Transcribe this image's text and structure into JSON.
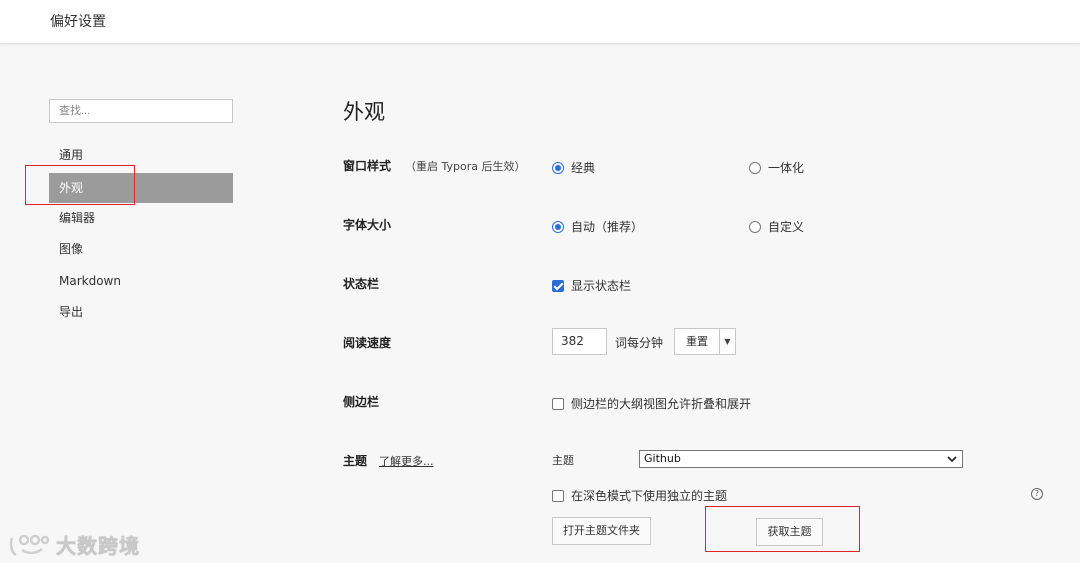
{
  "window": {
    "title": "偏好设置"
  },
  "search": {
    "placeholder": "查找..."
  },
  "sidebar": {
    "items": [
      {
        "label": "通用"
      },
      {
        "label": "外观",
        "active": true
      },
      {
        "label": "编辑器"
      },
      {
        "label": "图像"
      },
      {
        "label": "Markdown"
      },
      {
        "label": "导出"
      }
    ]
  },
  "main": {
    "heading": "外观",
    "window_style": {
      "label": "窗口样式",
      "hint": "（重启 Typora 后生效）",
      "options": [
        "经典",
        "一体化"
      ],
      "selected": "经典"
    },
    "font_size": {
      "label": "字体大小",
      "options": [
        "自动（推荐）",
        "自定义"
      ],
      "selected": "自动（推荐）"
    },
    "status_bar": {
      "label": "状态栏",
      "checkbox_label": "显示状态栏",
      "checked": true
    },
    "reading_speed": {
      "label": "阅读速度",
      "value": "382",
      "unit": "词每分钟",
      "reset_label": "重置",
      "caret": "▼"
    },
    "sidebar_section": {
      "label": "侧边栏",
      "checkbox_label": "侧边栏的大纲视图允许折叠和展开",
      "checked": false
    },
    "theme": {
      "label": "主题",
      "learn_more": "了解更多...",
      "select_label": "主题",
      "selected": "Github",
      "dark_mode_label": "在深色模式下使用独立的主题",
      "dark_mode_checked": false,
      "open_folder_label": "打开主题文件夹",
      "get_themes_label": "获取主题",
      "help_glyph": "?"
    }
  },
  "watermark": {
    "text": "大数跨境"
  },
  "colors": {
    "accent": "#2b6fd6",
    "highlight": "#e0242c",
    "active_nav": "#9b9b9b"
  }
}
